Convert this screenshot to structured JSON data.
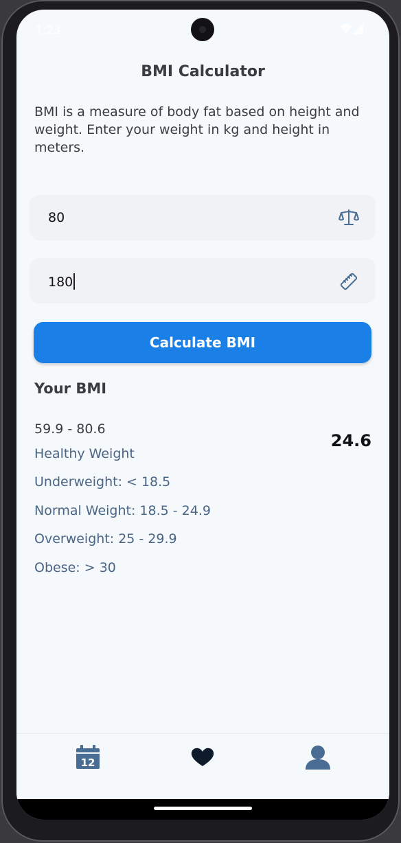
{
  "status_bar": {
    "time": "1:23"
  },
  "app": {
    "title": "BMI Calculator"
  },
  "description": "BMI is a measure of body fat based on height and weight. Enter your weight in kg and height in meters.",
  "weight_field": {
    "value": "80",
    "icon": "scale-icon"
  },
  "height_field": {
    "value": "180",
    "icon": "ruler-icon"
  },
  "calculate_button": {
    "label": "Calculate BMI"
  },
  "result": {
    "heading": "Your BMI",
    "range": "59.9 - 80.6",
    "bmi": "24.6",
    "status": "Healthy Weight",
    "categories": [
      "Underweight: < 18.5",
      "Normal Weight: 18.5 - 24.9",
      "Overweight: 25 - 29.9",
      "Obese: > 30"
    ]
  },
  "bottom_nav": {
    "items": [
      {
        "icon": "calendar-icon",
        "text": "12"
      },
      {
        "icon": "heart-icon"
      },
      {
        "icon": "person-icon"
      }
    ]
  },
  "colors": {
    "accent": "#1a7fe6",
    "background": "#f6f9fc",
    "field_bg": "#f1f2f5",
    "label_blue": "#4a6585",
    "icon_blue": "#4a6d94"
  }
}
